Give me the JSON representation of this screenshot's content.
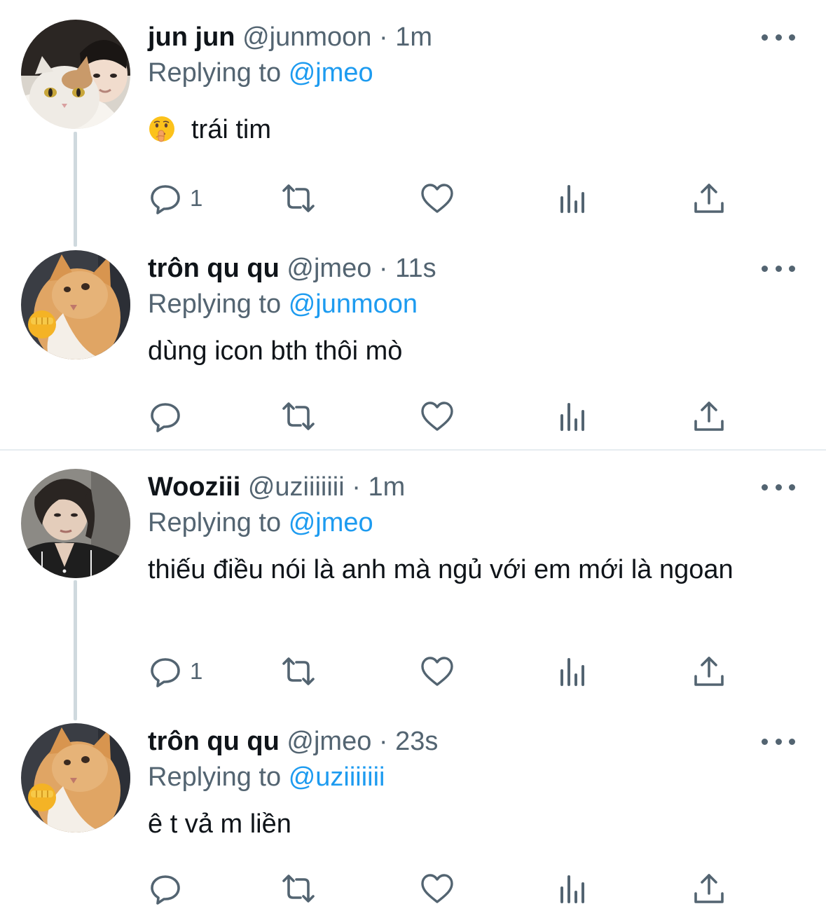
{
  "colors": {
    "text": "#0f1419",
    "muted": "#536471",
    "link": "#1d9bf0",
    "thread_line": "#cfd9de",
    "divider": "#e6ecf0"
  },
  "tweets": [
    {
      "name": "jun jun",
      "handle": "@junmoon",
      "separator": "·",
      "time": "1m",
      "replying_prefix": "Replying to",
      "replying_to": "@jmeo",
      "emoji": "shushing-face-icon",
      "text": "trái tim",
      "reply_count": "1"
    },
    {
      "name": "trôn qu qu",
      "handle": "@jmeo",
      "separator": "·",
      "time": "11s",
      "replying_prefix": "Replying to",
      "replying_to": "@junmoon",
      "text": "dùng icon bth thôi mò",
      "reply_count": ""
    },
    {
      "name": "Wooziii",
      "handle": "@uziiiiiii",
      "separator": "·",
      "time": "1m",
      "replying_prefix": "Replying to",
      "replying_to": "@jmeo",
      "text": "thiếu điều nói là anh mà ngủ với em mới là ngoan",
      "reply_count": "1"
    },
    {
      "name": "trôn qu qu",
      "handle": "@jmeo",
      "separator": "·",
      "time": "23s",
      "replying_prefix": "Replying to",
      "replying_to": "@uziiiiiii",
      "text": "ê t vả m liền",
      "reply_count": ""
    }
  ]
}
